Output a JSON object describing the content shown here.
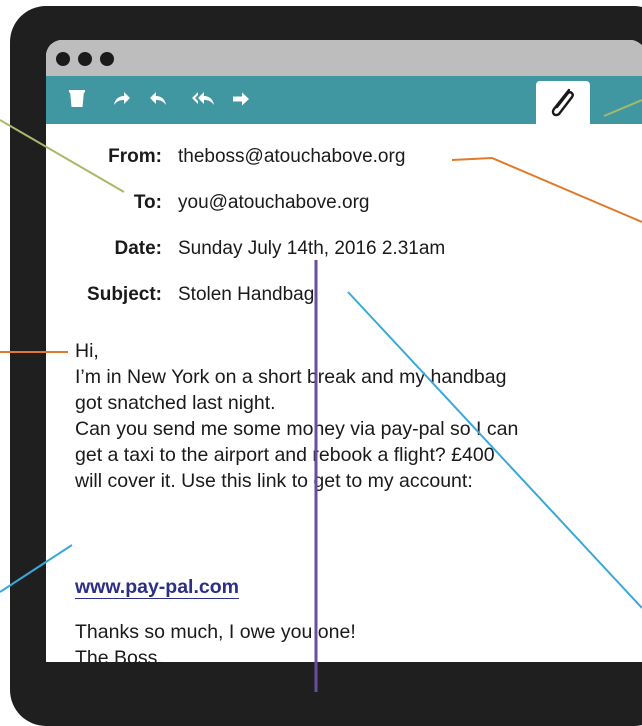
{
  "toolbar": {
    "icons": [
      "trash-icon",
      "forward-icon",
      "reply-icon",
      "reply-all-icon",
      "next-icon"
    ],
    "attachment_icon": "paperclip-icon"
  },
  "header": {
    "from_label": "From:",
    "from_value": "theboss@atouchabove.org",
    "to_label": "To:",
    "to_value": "you@atouchabove.org",
    "date_label": "Date:",
    "date_value": "Sunday July 14th, 2016 2.31am",
    "subject_label": "Subject:",
    "subject_value": "Stolen Handbag"
  },
  "body": {
    "lines": [
      "Hi,",
      "I’m in New York on a short break and my handbag",
      "got snatched last night.",
      "Can you send me some money via pay-pal so I can",
      "get a taxi to the airport and rebook a flight? £400",
      "will cover it. Use this link to get to my account:"
    ],
    "link": "www.pay-pal.com",
    "closing": [
      "Thanks so much, I owe you one!",
      "The Boss."
    ]
  },
  "colors": {
    "bezel": "#1f1f1f",
    "titlebar": "#bdbdbd",
    "toolbar": "#4097a2",
    "link": "#2b2f86",
    "callout_green": "#a9b96a",
    "callout_orange": "#e07a2a",
    "callout_blue": "#3aa8d8",
    "callout_purple": "#6a4ca3"
  }
}
